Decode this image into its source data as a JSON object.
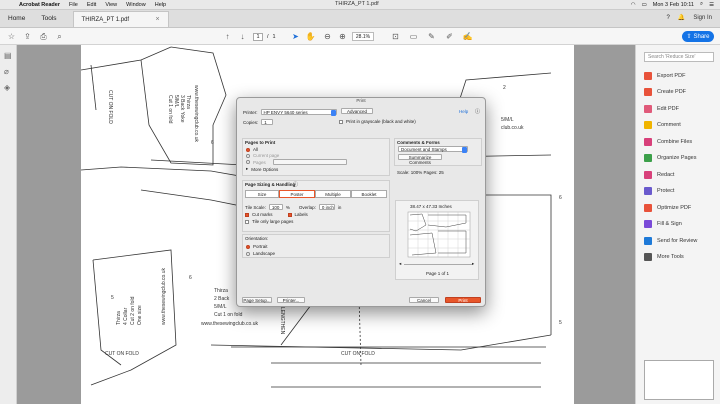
{
  "menubar": {
    "app": "Acrobat Reader",
    "items": [
      "File",
      "Edit",
      "View",
      "Window",
      "Help"
    ],
    "clock": "Mon 3 Feb 10:11"
  },
  "tabs": {
    "home": "Home",
    "tools": "Tools",
    "document": "THIRZA_PT 1.pdf",
    "window_title": "THIRZA_PT 1.pdf",
    "sign_in": "Sign In"
  },
  "toolbar": {
    "page_current": "1",
    "page_total": "1",
    "zoom": "28.1%",
    "share": "Share"
  },
  "pattern": {
    "left_top": {
      "lines": [
        "Thirza",
        "3 Back Yoke",
        "5/M/L",
        "Cut 1 on fold"
      ],
      "url": "www.thesewingclub.co.uk",
      "fold": "CUT ON FOLD"
    },
    "left_bottom": {
      "lines": [
        "Thirza",
        "4 Collar",
        "Cut 2 on fold",
        "One size"
      ],
      "url": "www.thesewingclub.co.uk",
      "fold": "CUT ON FOLD"
    },
    "center": {
      "lines": [
        "Thirza",
        "2 Back",
        "5/M/L",
        "Cut 1 on fold"
      ],
      "url": "www.thesewingclub.co.uk",
      "fold": "CUT ON FOLD"
    },
    "center_label": "LENGTHEN",
    "right_text": [
      "5/M/L",
      "club.co.uk"
    ],
    "numbers": [
      "2",
      "6",
      "5",
      "6",
      "5",
      "6"
    ]
  },
  "rightrail": {
    "search_placeholder": "Search 'Reduce Size'",
    "tools": [
      {
        "label": "Export PDF",
        "color": "#e8523a"
      },
      {
        "label": "Create PDF",
        "color": "#e8523a"
      },
      {
        "label": "Edit PDF",
        "color": "#e05a7a"
      },
      {
        "label": "Comment",
        "color": "#f0b400"
      },
      {
        "label": "Combine Files",
        "color": "#d8407a"
      },
      {
        "label": "Organize Pages",
        "color": "#3ca04a"
      },
      {
        "label": "Redact",
        "color": "#d8407a"
      },
      {
        "label": "Protect",
        "color": "#6a5acd"
      },
      {
        "label": "Optimize PDF",
        "color": "#e8523a"
      },
      {
        "label": "Fill & Sign",
        "color": "#7a4ad8"
      },
      {
        "label": "Send for Review",
        "color": "#1e7ad8"
      },
      {
        "label": "More Tools",
        "color": "#555555"
      }
    ]
  },
  "dialog": {
    "title": "Print",
    "printer_label": "Printer:",
    "printer_value": "HP ENVY 5640 series",
    "advanced": "Advanced",
    "help": "Help",
    "copies_label": "Copies:",
    "copies_value": "1",
    "grayscale": "Print in grayscale (black and white)",
    "pages_title": "Pages to Print",
    "pages_options": [
      "All",
      "Current page",
      "Pages",
      "More Options"
    ],
    "sizing_title": "Page Sizing & Handling",
    "sizing_tabs": [
      "Size",
      "Poster",
      "Multiple",
      "Booklet"
    ],
    "tile_scale_label": "Tile Scale:",
    "tile_scale_value": "100",
    "tile_scale_unit": "%",
    "overlap_label": "Overlap:",
    "overlap_value": "0 inch",
    "overlap_unit": "in",
    "cut_marks": "Cut marks",
    "labels": "Labels",
    "tile_large": "Tile only large pages",
    "orientation_title": "Orientation:",
    "portrait": "Portrait",
    "landscape": "Landscape",
    "comments_title": "Comments & Forms",
    "comments_value": "Document and Stamps",
    "summarize": "Summarize Comments",
    "scale_info": "Scale: 100% Pages: 25",
    "paper_size": "38.47 x 47.33 Inches",
    "page_of": "Page 1 of 1",
    "page_setup": "Page Setup...",
    "printer_btn": "Printer...",
    "cancel": "Cancel",
    "print": "Print"
  }
}
